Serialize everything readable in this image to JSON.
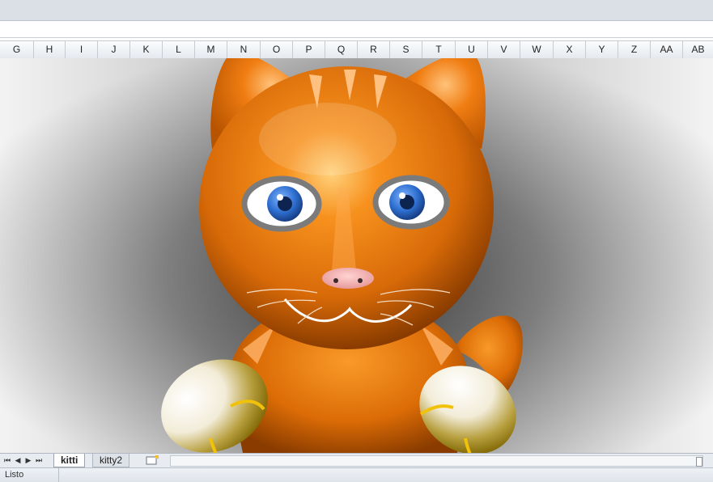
{
  "columns": [
    "G",
    "H",
    "I",
    "J",
    "K",
    "L",
    "M",
    "N",
    "O",
    "P",
    "Q",
    "R",
    "S",
    "T",
    "U",
    "V",
    "W",
    "X",
    "Y",
    "Z",
    "AA",
    "AB"
  ],
  "sheet_tabs": [
    {
      "label": "kitti",
      "active": true
    },
    {
      "label": "kitty2",
      "active": false
    }
  ],
  "status": {
    "text": "Listo"
  },
  "colors": {
    "fur": "#e8760c",
    "fur_light": "#ffb347",
    "eye_iris": "#2e6fd0",
    "nose": "#f2a9a9",
    "paw_gold": "#a98300"
  }
}
